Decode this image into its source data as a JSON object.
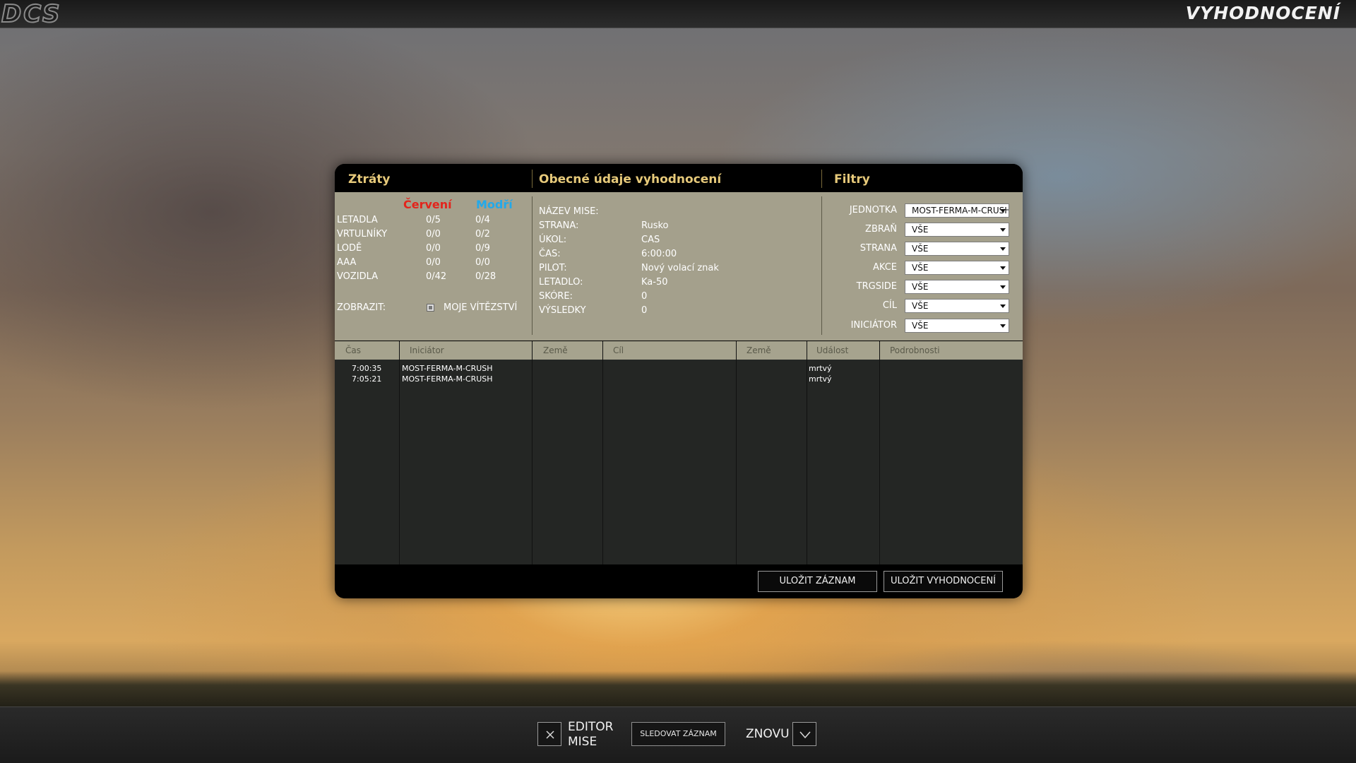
{
  "app": {
    "logo_text": "DCS",
    "title": "VYHODNOCENÍ"
  },
  "panel": {
    "headers": {
      "losses": "Ztráty",
      "general": "Obecné údaje vyhodnocení",
      "filters": "Filtry"
    },
    "losses": {
      "red_label": "Červení",
      "blue_label": "Modří",
      "rows": [
        {
          "label": "LETADLA",
          "red": "0/5",
          "blue": "0/4"
        },
        {
          "label": "VRTULNÍKY",
          "red": "0/0",
          "blue": "0/2"
        },
        {
          "label": "LODĚ",
          "red": "0/0",
          "blue": "0/9"
        },
        {
          "label": "AAA",
          "red": "0/0",
          "blue": "0/0"
        },
        {
          "label": "VOZIDLA",
          "red": "0/42",
          "blue": "0/28"
        }
      ],
      "show_label": "ZOBRAZIT:",
      "my_victories_label": "MOJE VÍTĚZSTVÍ"
    },
    "general": {
      "rows": [
        {
          "label": "NÁZEV MISE:",
          "value": ""
        },
        {
          "label": "STRANA:",
          "value": "Rusko"
        },
        {
          "label": "ÚKOL:",
          "value": "CAS"
        },
        {
          "label": "ČAS:",
          "value": "6:00:00"
        },
        {
          "label": "PILOT:",
          "value": "Nový volací znak"
        },
        {
          "label": "LETADLO:",
          "value": "Ka-50"
        },
        {
          "label": "SKÓRE:",
          "value": "0"
        },
        {
          "label": "VÝSLEDKY",
          "value": "0"
        }
      ]
    },
    "filters": [
      {
        "label": "JEDNOTKA",
        "value": "MOST-FERMA-M-CRUSH"
      },
      {
        "label": "ZBRAŇ",
        "value": "VŠE"
      },
      {
        "label": "STRANA",
        "value": "VŠE"
      },
      {
        "label": "AKCE",
        "value": "VŠE"
      },
      {
        "label": "TRGSIDE",
        "value": "VŠE"
      },
      {
        "label": "CÍL",
        "value": "VŠE"
      },
      {
        "label": "INICIÁTOR",
        "value": "VŠE"
      }
    ],
    "table": {
      "columns": [
        "Čas",
        "Iniciátor",
        "Země",
        "Cíl",
        "Země",
        "Událost",
        "Podrobnosti"
      ],
      "rows": [
        {
          "time": "7:00:35",
          "initiator": "MOST-FERMA-M-CRUSH",
          "country": "",
          "target": "",
          "target_country": "",
          "event": "mrtvý",
          "details": ""
        },
        {
          "time": "7:05:21",
          "initiator": "MOST-FERMA-M-CRUSH",
          "country": "",
          "target": "",
          "target_country": "",
          "event": "mrtvý",
          "details": ""
        }
      ]
    },
    "buttons": {
      "save_track": "ULOŽIT ZÁZNAM",
      "save_debrief": "ULOŽIT VYHODNOCENÍ"
    }
  },
  "bottom": {
    "editor_line1": "EDITOR",
    "editor_line2": "MISE",
    "watch_track": "SLEDOVAT ZÁZNAM",
    "again": "ZNOVU"
  }
}
